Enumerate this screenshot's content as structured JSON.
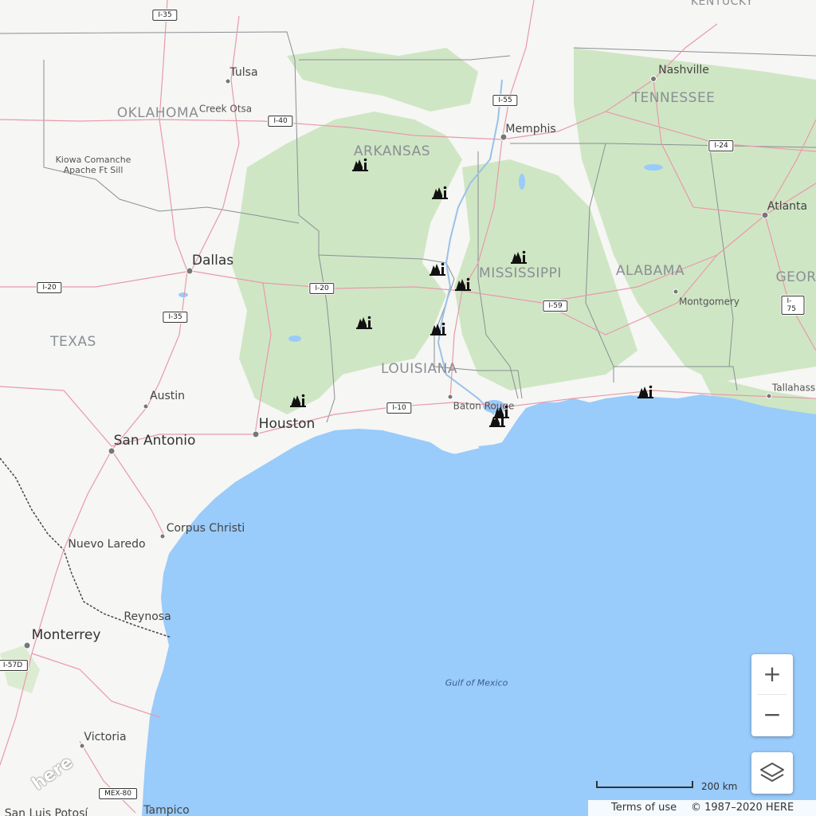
{
  "map": {
    "colors": {
      "land": "#f6f6f4",
      "forest": "#cfe6c4",
      "water": "#99cbfb",
      "road": "#e89aab",
      "border": "#8a8f94"
    },
    "state_labels": [
      {
        "id": "oklahoma",
        "text": "OKLAHOMA"
      },
      {
        "id": "arkansas",
        "text": "ARKANSAS"
      },
      {
        "id": "tennessee",
        "text": "TENNESSEE"
      },
      {
        "id": "mississippi",
        "text": "MISSISSIPPI"
      },
      {
        "id": "alabama",
        "text": "ALABAMA"
      },
      {
        "id": "texas",
        "text": "TEXAS"
      },
      {
        "id": "louisiana",
        "text": "LOUISIANA"
      },
      {
        "id": "georgia",
        "text": "GEOR"
      },
      {
        "id": "kentucky",
        "text": "KENTUCKY"
      }
    ],
    "city_labels": [
      {
        "id": "tulsa",
        "text": "Tulsa"
      },
      {
        "id": "creek-otsa",
        "text": "Creek Otsa"
      },
      {
        "id": "kiowa",
        "text": "Kiowa Comanche\nApache Ft Sill"
      },
      {
        "id": "memphis",
        "text": "Memphis"
      },
      {
        "id": "nashville",
        "text": "Nashville"
      },
      {
        "id": "atlanta",
        "text": "Atlanta"
      },
      {
        "id": "dallas",
        "text": "Dallas"
      },
      {
        "id": "montgomery",
        "text": "Montgomery"
      },
      {
        "id": "austin",
        "text": "Austin"
      },
      {
        "id": "houston",
        "text": "Houston"
      },
      {
        "id": "san-antonio",
        "text": "San Antonio"
      },
      {
        "id": "baton-rouge",
        "text": "Baton Rouge"
      },
      {
        "id": "tallahassee",
        "text": "Tallahass"
      },
      {
        "id": "corpus-christi",
        "text": "Corpus Christi"
      },
      {
        "id": "nuevo-laredo",
        "text": "Nuevo Laredo"
      },
      {
        "id": "reynosa",
        "text": "Reynosa"
      },
      {
        "id": "monterrey",
        "text": "Monterrey"
      },
      {
        "id": "victoria",
        "text": "Victoria"
      },
      {
        "id": "tampico",
        "text": "Tampico"
      },
      {
        "id": "san-luis-potosi",
        "text": "San Luis Potosí"
      }
    ],
    "water_labels": [
      {
        "id": "gulf-of-mexico",
        "text": "Gulf of Mexico"
      }
    ],
    "highway_shields": [
      {
        "id": "i35-north",
        "text": "I-35"
      },
      {
        "id": "i40",
        "text": "I-40"
      },
      {
        "id": "i55",
        "text": "I-55"
      },
      {
        "id": "i24",
        "text": "I-24"
      },
      {
        "id": "i20-west",
        "text": "I-20"
      },
      {
        "id": "i20-mid",
        "text": "I-20"
      },
      {
        "id": "i35-south",
        "text": "I-35"
      },
      {
        "id": "i59",
        "text": "I-59"
      },
      {
        "id": "i75",
        "text": "I-75"
      },
      {
        "id": "i10",
        "text": "I-10"
      },
      {
        "id": "i57d",
        "text": "I-57D"
      },
      {
        "id": "mex80",
        "text": "MEX-80"
      }
    ],
    "markers": {
      "icon": "national-park-icon",
      "count": 11
    }
  },
  "controls": {
    "zoom_in_label": "+",
    "zoom_out_label": "−",
    "layers_icon": "layers-icon"
  },
  "scale": {
    "label": "200 km"
  },
  "footer": {
    "terms": "Terms of use",
    "copyright": "© 1987–2020 HERE"
  },
  "brand": {
    "logo": "here"
  }
}
